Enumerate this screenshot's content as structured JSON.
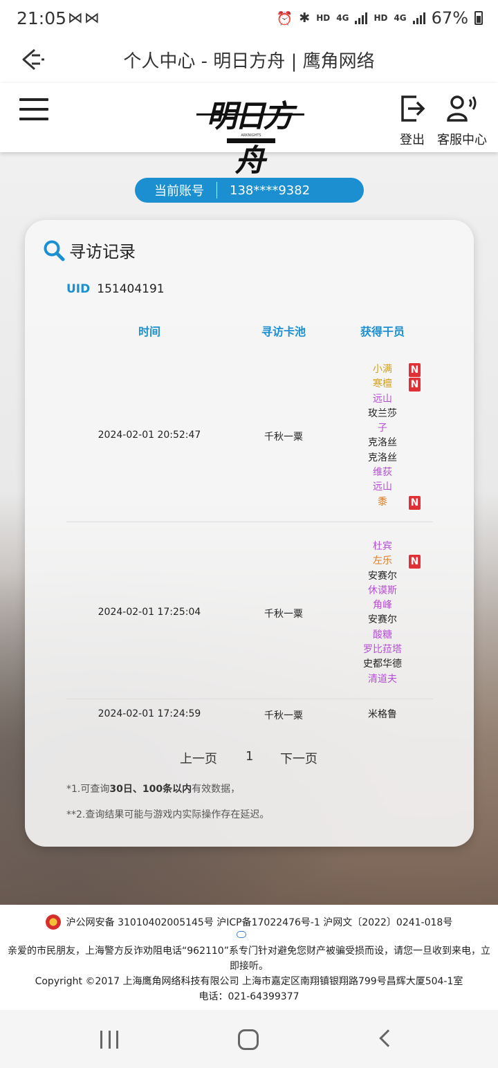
{
  "status_bar": {
    "time": "21:05",
    "left_icons": "⋈⋈",
    "hd1": "HD",
    "net1": "4G",
    "hd2": "HD",
    "net2": "4G",
    "battery": "67%"
  },
  "browser": {
    "title": "个人中心 - 明日方舟 | 鹰角网络"
  },
  "header": {
    "logo_text": "明日方舟",
    "logo_sub": "ARKNIGHTS",
    "logout_label": "登出",
    "service_label": "客服中心"
  },
  "account": {
    "label": "当前账号",
    "value": "138****9382"
  },
  "card": {
    "title": "寻访记录",
    "uid_label": "UID",
    "uid_value": "151404191",
    "columns": [
      "时间",
      "寻访卡池",
      "获得干员"
    ],
    "records": [
      {
        "time": "2024-02-01 20:52:47",
        "pool": "千秋一粟",
        "operators": [
          {
            "name": "小满",
            "color": "#d4a017",
            "new": "N"
          },
          {
            "name": "寒檀",
            "color": "#d4a017",
            "new": "N"
          },
          {
            "name": "远山",
            "color": "#b64fd6",
            "new": ""
          },
          {
            "name": "玫兰莎",
            "color": "#222222",
            "new": ""
          },
          {
            "name": "子",
            "color": "#b64fd6",
            "new": ""
          },
          {
            "name": "克洛丝",
            "color": "#222222",
            "new": ""
          },
          {
            "name": "克洛丝",
            "color": "#222222",
            "new": ""
          },
          {
            "name": "维荻",
            "color": "#b64fd6",
            "new": ""
          },
          {
            "name": "远山",
            "color": "#b64fd6",
            "new": ""
          },
          {
            "name": "黍",
            "color": "#e07b1f",
            "new": "N"
          }
        ]
      },
      {
        "time": "2024-02-01 17:25:04",
        "pool": "千秋一粟",
        "operators": [
          {
            "name": "杜宾",
            "color": "#b64fd6",
            "new": ""
          },
          {
            "name": "左乐",
            "color": "#e07b1f",
            "new": "N"
          },
          {
            "name": "安赛尔",
            "color": "#222222",
            "new": ""
          },
          {
            "name": "休谟斯",
            "color": "#b64fd6",
            "new": ""
          },
          {
            "name": "角峰",
            "color": "#b64fd6",
            "new": ""
          },
          {
            "name": "安赛尔",
            "color": "#222222",
            "new": ""
          },
          {
            "name": "酸糖",
            "color": "#b64fd6",
            "new": ""
          },
          {
            "name": "罗比菈塔",
            "color": "#b64fd6",
            "new": ""
          },
          {
            "name": "史都华德",
            "color": "#222222",
            "new": ""
          },
          {
            "name": "清道夫",
            "color": "#b64fd6",
            "new": ""
          }
        ]
      },
      {
        "time": "2024-02-01 17:24:59",
        "pool": "千秋一粟",
        "operators": [
          {
            "name": "米格鲁",
            "color": "#222222",
            "new": ""
          }
        ]
      }
    ],
    "pager": {
      "prev": "上一页",
      "page": "1",
      "next": "下一页"
    },
    "note1_prefix": "*1.可查询",
    "note1_bold": "30日、100条以内",
    "note1_suffix": "有效数据，",
    "note2": "**2.查询结果可能与游戏内实际操作存在延迟。"
  },
  "footer": {
    "line1": "沪公网安备 31010402005145号  沪ICP备17022476号-1  沪网文〔2022〕0241-018号",
    "line2": "亲爱的市民朋友，上海警方反诈劝阻电话“962110”系专门针对避免您财产被骗受损而设，请您一旦收到来电，立即接听。",
    "line3": "Copyright ©2017 上海鹰角网络科技有限公司  上海市嘉定区南翔镇银翔路799号昌辉大厦504-1室",
    "line4": "电话：021-64399377"
  }
}
